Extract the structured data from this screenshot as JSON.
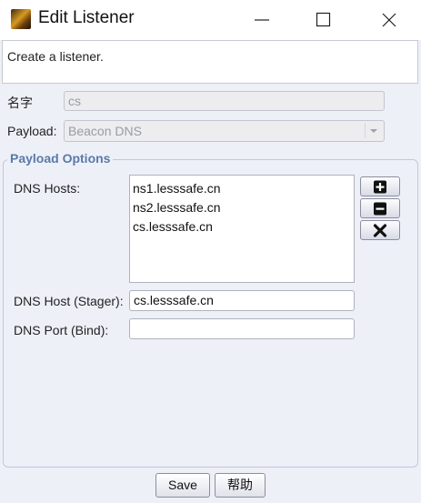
{
  "window": {
    "title": "Edit Listener",
    "description": "Create a listener."
  },
  "form": {
    "name_label": "名字",
    "name_value": "cs",
    "payload_label": "Payload:",
    "payload_value": "Beacon DNS"
  },
  "payload_options": {
    "title": "Payload Options",
    "dns_hosts_label": "DNS Hosts:",
    "dns_hosts": [
      "ns1.lesssafe.cn",
      "ns2.lesssafe.cn",
      "cs.lesssafe.cn"
    ],
    "stager_label": "DNS Host (Stager):",
    "stager_value": "cs.lesssafe.cn",
    "port_label": "DNS Port (Bind):",
    "port_value": ""
  },
  "buttons": {
    "save": "Save",
    "help": "帮助"
  },
  "icons": {
    "app": "app-logo-icon",
    "add": "plus-icon",
    "remove": "minus-icon",
    "clear": "x-icon"
  }
}
